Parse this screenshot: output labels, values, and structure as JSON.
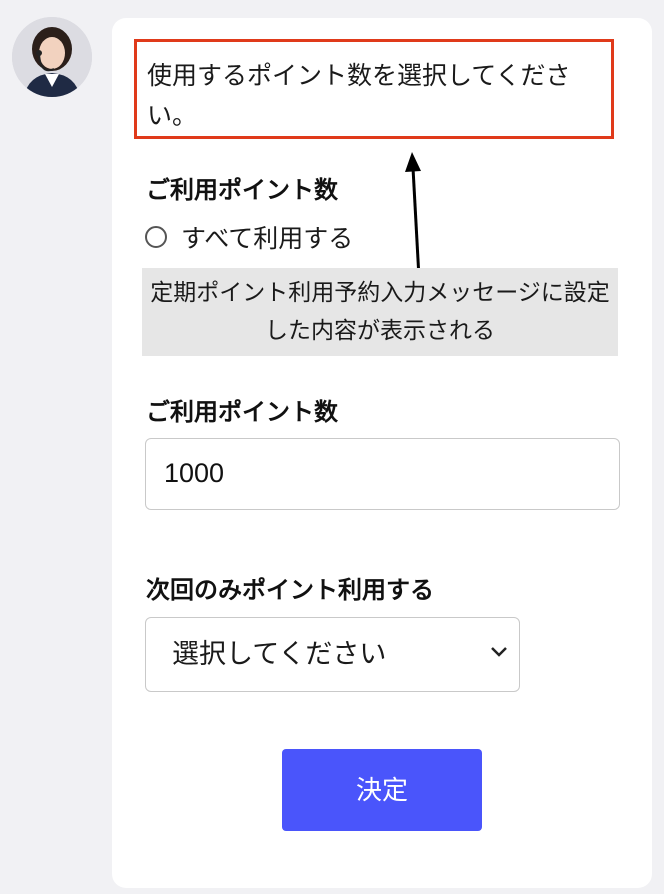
{
  "chat": {
    "avatar_icon": "support-agent-avatar"
  },
  "form": {
    "prompt_message": "使用するポイント数を選択してください。",
    "section1_label": "ご利用ポイント数",
    "radio_use_all_label": "すべて利用する",
    "annotation_note": "定期ポイント利用予約入力メッセージに設定した内容が表示される",
    "section2_label": "ご利用ポイント数",
    "points_input_value": "1000",
    "next_only_label": "次回のみポイント利用する",
    "select_value": "選択してください",
    "submit_label": "決定"
  },
  "colors": {
    "highlight_border": "#e03a1a",
    "button_bg": "#4a55fb",
    "note_bg": "#e6e6e6"
  }
}
